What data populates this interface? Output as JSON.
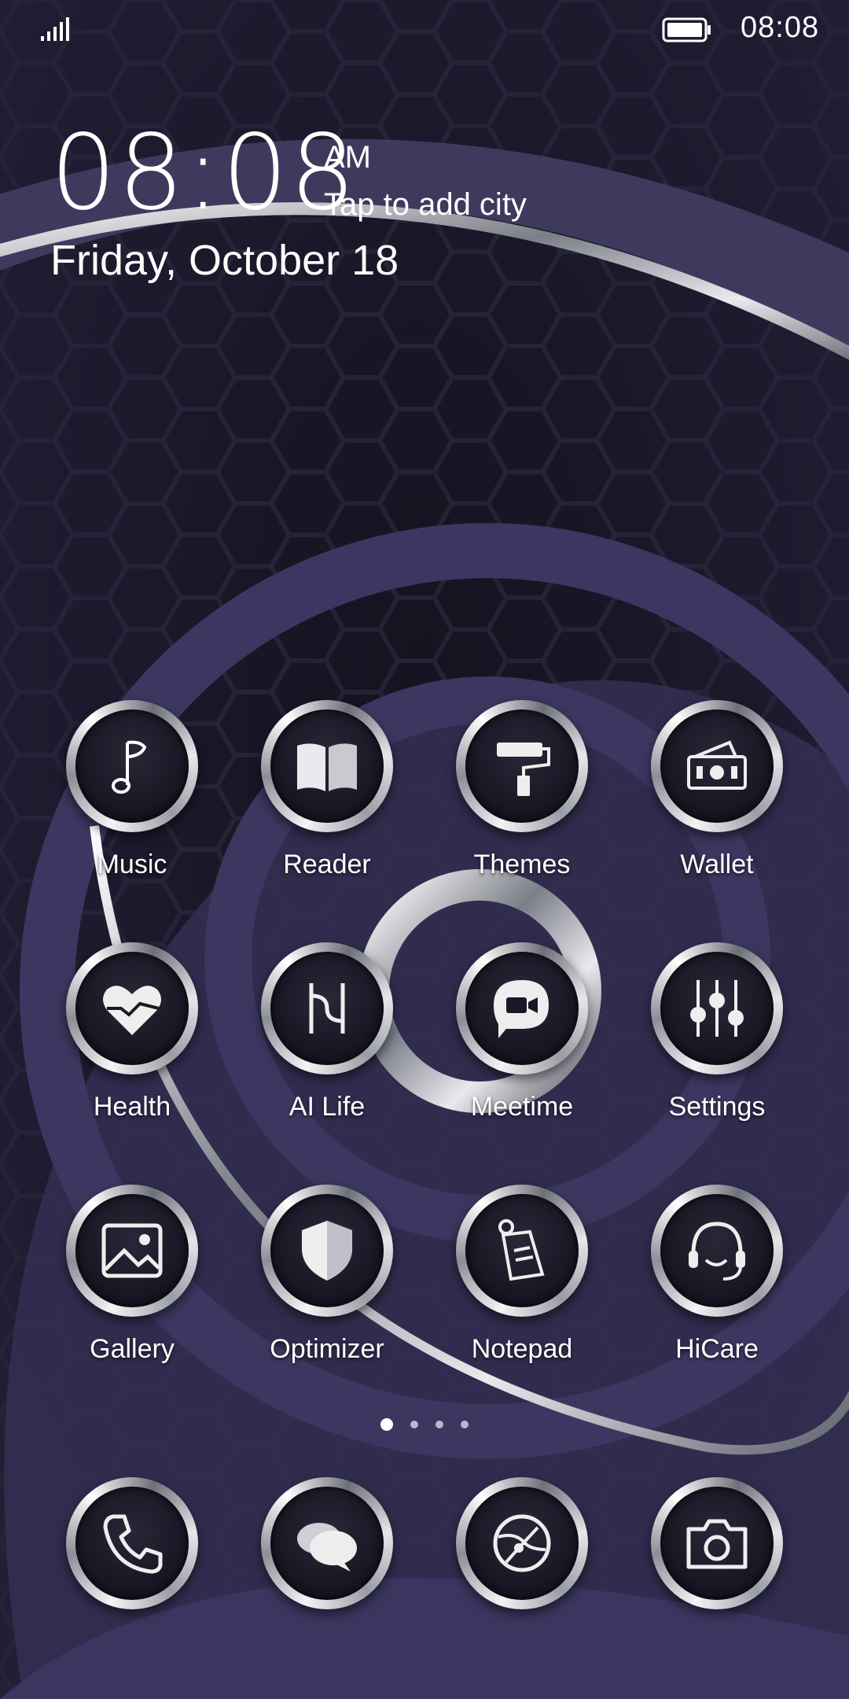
{
  "status_bar": {
    "time": "08:08"
  },
  "clock": {
    "time": "08:08",
    "ampm": "AM",
    "city_prompt": "Tap to add city",
    "date": "Friday, October 18"
  },
  "apps": [
    {
      "label": "Music",
      "icon": "music-note-icon"
    },
    {
      "label": "Reader",
      "icon": "book-icon"
    },
    {
      "label": "Themes",
      "icon": "paint-roller-icon"
    },
    {
      "label": "Wallet",
      "icon": "wallet-icon"
    },
    {
      "label": "Health",
      "icon": "heart-icon"
    },
    {
      "label": "AI Life",
      "icon": "ai-life-icon"
    },
    {
      "label": "Meetime",
      "icon": "video-chat-icon"
    },
    {
      "label": "Settings",
      "icon": "sliders-icon"
    },
    {
      "label": "Gallery",
      "icon": "image-icon"
    },
    {
      "label": "Optimizer",
      "icon": "shield-icon"
    },
    {
      "label": "Notepad",
      "icon": "notepad-icon"
    },
    {
      "label": "HiCare",
      "icon": "headset-icon"
    }
  ],
  "dock": [
    {
      "icon": "phone-icon"
    },
    {
      "icon": "messages-icon"
    },
    {
      "icon": "browser-icon"
    },
    {
      "icon": "camera-icon"
    }
  ],
  "pager": {
    "pages": 4,
    "active": 1
  }
}
